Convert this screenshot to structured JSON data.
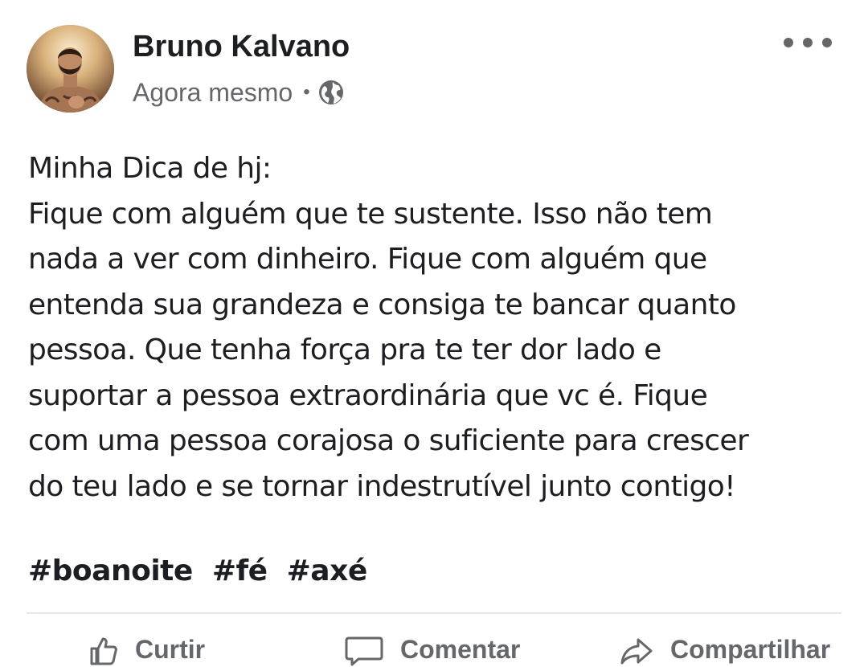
{
  "post": {
    "author": {
      "name": "Bruno Kalvano",
      "avatar_icon": "profile-photo"
    },
    "meta": {
      "time": "Agora mesmo",
      "separator": "•",
      "privacy_icon": "globe-icon"
    },
    "more_icon": "ellipsis-icon",
    "text_lines": [
      "Minha Dica de hj:",
      "Fique com alguém que te sustente. Isso não tem",
      "nada a ver com dinheiro. Fique com alguém que",
      "entenda sua grandeza e consiga te bancar quanto",
      "pessoa. Que tenha força pra te ter dor lado e",
      "suportar a pessoa extraordinária que vc é. Fique",
      "com uma pessoa corajosa o suficiente para crescer",
      "do teu lado e se tornar indestrutível junto contigo!"
    ],
    "hashtags": [
      "#boanoite",
      "#fé",
      "#axé"
    ]
  },
  "actions": [
    {
      "label": "Curtir",
      "icon": "like-icon"
    },
    {
      "label": "Comentar",
      "icon": "comment-icon"
    },
    {
      "label": "Compartilhar",
      "icon": "share-icon"
    }
  ],
  "colors": {
    "text_primary": "#1c1e21",
    "text_secondary": "#65676b",
    "divider": "#e4e6eb",
    "background": "#ffffff"
  }
}
